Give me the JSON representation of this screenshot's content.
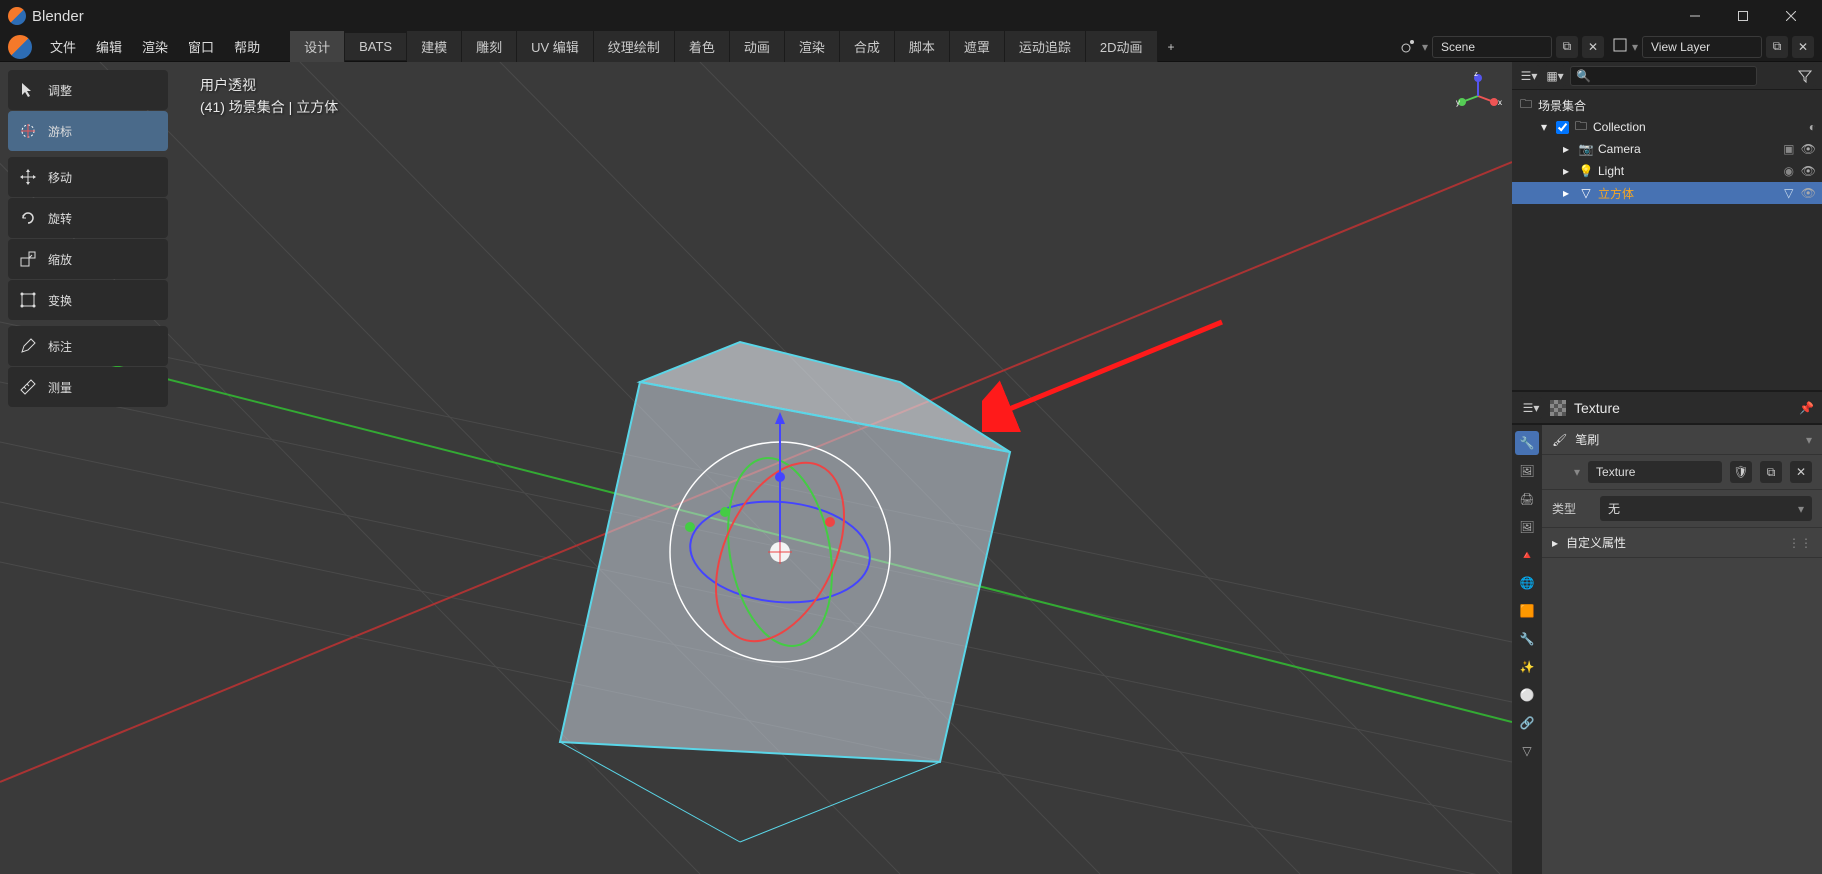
{
  "window": {
    "title": "Blender"
  },
  "menubar": [
    "文件",
    "编辑",
    "渲染",
    "窗口",
    "帮助"
  ],
  "workspaces": {
    "tabs": [
      "设计",
      "BATS",
      "建模",
      "雕刻",
      "UV 编辑",
      "纹理绘制",
      "着色",
      "动画",
      "渲染",
      "合成",
      "脚本",
      "遮罩",
      "运动追踪",
      "2D动画"
    ],
    "active": 0
  },
  "header": {
    "scene_label": "Scene",
    "viewlayer_label": "View Layer"
  },
  "viewport": {
    "overlay_line1": "用户透视",
    "overlay_line2": "(41) 场景集合 | 立方体",
    "axis": {
      "x": "x",
      "y": "y",
      "z": "z"
    }
  },
  "tools": {
    "select": "调整",
    "cursor": "游标",
    "move": "移动",
    "rotate": "旋转",
    "scale": "缩放",
    "transform": "变换",
    "annotate": "标注",
    "measure": "测量"
  },
  "outliner": {
    "root": "场景集合",
    "collection": "Collection",
    "items": [
      "Camera",
      "Light",
      "立方体"
    ],
    "selected": "立方体"
  },
  "properties": {
    "panel_title": "Texture",
    "brush_label": "笔刷",
    "texture_name": "Texture",
    "type_label": "类型",
    "type_value": "无",
    "custom_props": "自定义属性"
  }
}
